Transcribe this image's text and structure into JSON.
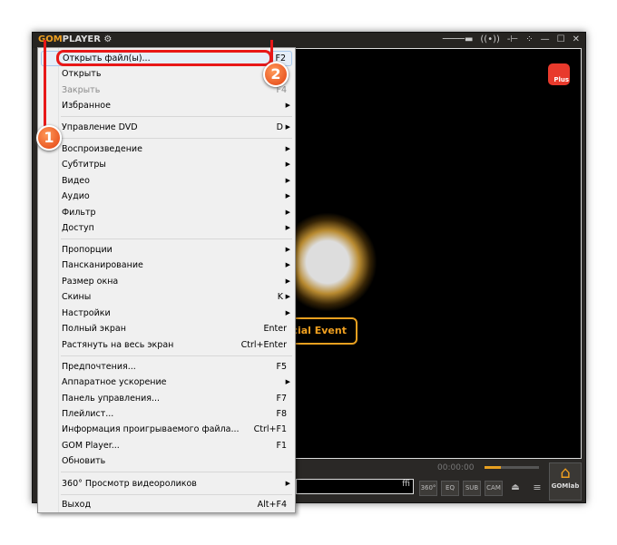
{
  "window": {
    "logo_gom": "GOM",
    "logo_player": "PLAYER",
    "controls": [
      "minimize",
      "maximize",
      "close"
    ]
  },
  "video": {
    "event_label": "cial Event",
    "plus_badge": "Plus"
  },
  "controlbar": {
    "time": "00:00:00",
    "volume_percent": 30,
    "input_text": "ffi",
    "buttons": [
      "360°",
      "EQ",
      "SUB",
      "CAM"
    ],
    "gomlab": "GOMlab"
  },
  "menu": {
    "items": [
      {
        "label": "Открыть файл(ы)...",
        "key": "F2"
      },
      {
        "label": "Открыть",
        "key": ""
      },
      {
        "label": "Закрыть",
        "key": "F4",
        "disabled": true
      },
      {
        "label": "Избранное",
        "sub": true
      },
      {
        "label": "Управление DVD",
        "key": "D",
        "sub": true
      },
      {
        "label": "Воспроизведение",
        "sub": true
      },
      {
        "label": "Субтитры",
        "sub": true
      },
      {
        "label": "Видео",
        "sub": true
      },
      {
        "label": "Аудио",
        "sub": true
      },
      {
        "label": "Фильтр",
        "sub": true
      },
      {
        "label": "Доступ",
        "sub": true
      },
      {
        "label": "Пропорции",
        "sub": true
      },
      {
        "label": "Пансканирование",
        "sub": true
      },
      {
        "label": "Размер окна",
        "sub": true
      },
      {
        "label": "Скины",
        "key": "K",
        "sub": true
      },
      {
        "label": "Настройки",
        "sub": true
      },
      {
        "label": "Полный экран",
        "key": "Enter"
      },
      {
        "label": "Растянуть на весь экран",
        "key": "Ctrl+Enter"
      },
      {
        "label": "Предпочтения...",
        "key": "F5"
      },
      {
        "label": "Аппаратное ускорение",
        "sub": true
      },
      {
        "label": "Панель управления...",
        "key": "F7"
      },
      {
        "label": "Плейлист...",
        "key": "F8"
      },
      {
        "label": "Информация проигрываемого файла...",
        "key": "Ctrl+F1"
      },
      {
        "label": "GOM Player...",
        "key": "F1"
      },
      {
        "label": "Обновить",
        "key": ""
      },
      {
        "label": "360° Просмотр видеороликов",
        "sub": true
      },
      {
        "label": "Выход",
        "key": "Alt+F4"
      }
    ]
  },
  "annotations": {
    "step1": "1",
    "step2": "2"
  }
}
